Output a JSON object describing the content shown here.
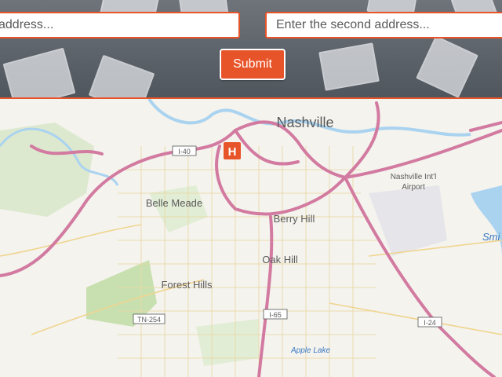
{
  "form": {
    "address1_value": "",
    "address1_placeholder": "address...",
    "address2_value": "",
    "address2_placeholder": "Enter the second address...",
    "submit_label": "Submit"
  },
  "map": {
    "city_label": "Nashville",
    "airport_label": "Nashville Int'l Airport",
    "airport_line1": "Nashville Int'l",
    "airport_line2": "Airport",
    "places": {
      "belle_meade": "Belle Meade",
      "berry_hill": "Berry Hill",
      "oak_hill": "Oak Hill",
      "forest_hills": "Forest Hills",
      "apple_lake": "Apple Lake",
      "smith": "Smi"
    },
    "highways": {
      "i40": "I-40",
      "i65": "I-65",
      "i24": "I-24",
      "tn254": "TN-254"
    },
    "hospital_icon_letter": "H",
    "colors": {
      "accent": "#e8542a",
      "highway": "#d27aa0",
      "water": "#aad3f0",
      "park": "#c8e0b0"
    }
  }
}
